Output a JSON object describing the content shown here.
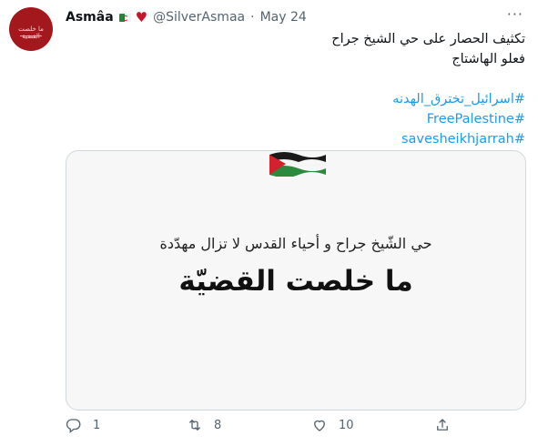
{
  "tweet": {
    "author_name": "Asmâa",
    "author_avatar_text": "ما خلصت القضية",
    "handle": "@SilverAsmaa",
    "separator": "·",
    "date": "May 24",
    "heart_glyph": "♥",
    "lines": [
      "تكثيف الحصار على حي الشيخ جراح",
      "فعلو الهاشتاج"
    ],
    "hashtags": [
      "#اسرائيل_تخترق_الهدنه",
      "#FreePalestine",
      "#savesheikhjarrah"
    ],
    "media": {
      "line1": "حي الشّيخ جراح و أحياء القدس لا تزال مهدّدة",
      "line2": "ما خلصت القضيّة"
    },
    "actions": {
      "reply_count": "1",
      "retweet_count": "8",
      "like_count": "10"
    }
  },
  "colors": {
    "link": "#1d9bf0",
    "muted": "#536471"
  }
}
